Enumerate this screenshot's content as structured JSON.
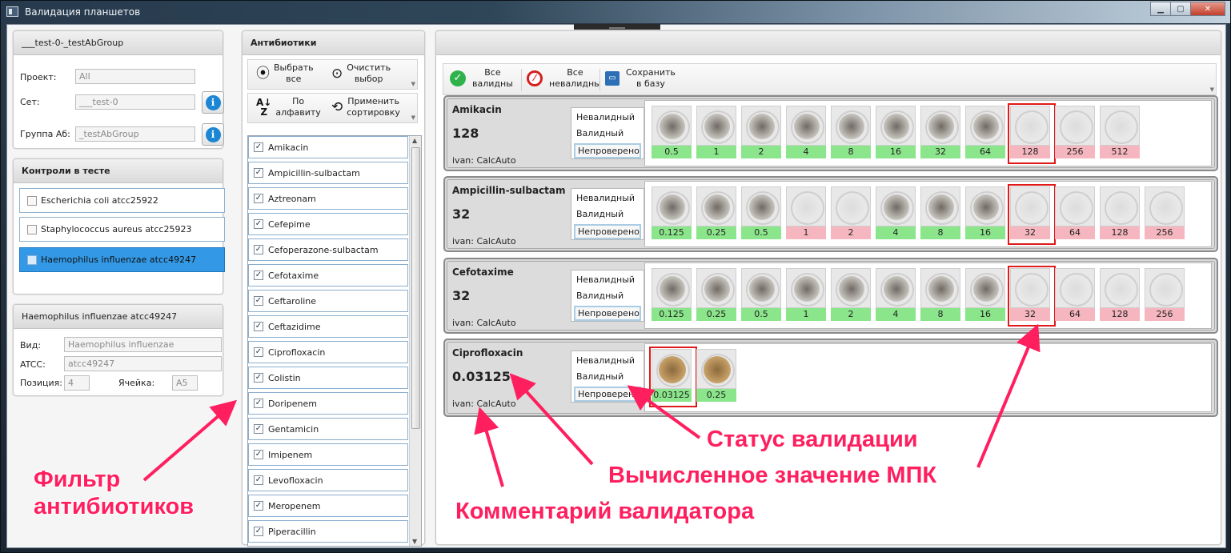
{
  "window": {
    "title": "Валидация планшетов",
    "buttons": [
      "minimize-icon",
      "maximize-icon",
      "close-icon"
    ]
  },
  "test_info": {
    "header": "___test-0-_testAbGroup",
    "project_label": "Проект:",
    "project_value": "All",
    "set_label": "Сет:",
    "set_value": "___test-0",
    "group_label": "Группа Аб:",
    "group_value": "_testAbGroup"
  },
  "controls": {
    "header": "Контроли в тесте",
    "items": [
      {
        "label": "Escherichia coli atcc25922",
        "selected": false
      },
      {
        "label": "Staphylococcus aureus atcc25923",
        "selected": false
      },
      {
        "label": "Haemophilus influenzae atcc49247",
        "selected": true
      }
    ]
  },
  "control_detail": {
    "header": "Haemophilus influenzae atcc49247",
    "species_label": "Вид:",
    "species_value": "Haemophilus influenzae",
    "atcc_label": "ATCC:",
    "atcc_value": "atcc49247",
    "position_label": "Позиция:",
    "position_value": "4",
    "cell_label": "Ячейка:",
    "cell_value": "A5"
  },
  "antibiotics_panel": {
    "header": "Антибиотики",
    "select_all": "Выбрать\nвсе",
    "clear": "Очистить\nвыбор",
    "sort_alpha": "По\nалфавиту",
    "apply_sort": "Применить\nсортировку",
    "items": [
      "Amikacin",
      "Ampicillin-sulbactam",
      "Aztreonam",
      "Cefepime",
      "Cefoperazone-sulbactam",
      "Cefotaxime",
      "Ceftaroline",
      "Ceftazidime",
      "Ciprofloxacin",
      "Colistin",
      "Doripenem",
      "Gentamicin",
      "Imipenem",
      "Levofloxacin",
      "Meropenem",
      "Piperacillin"
    ]
  },
  "right_toolbar": {
    "all_valid": "Все\nвалидны",
    "all_invalid": "Все\nневалидны",
    "save": "Сохранить\nв базу"
  },
  "status_options": {
    "invalid": "Невалидный",
    "valid": "Валидный",
    "unchecked": "Непроверено"
  },
  "results": [
    {
      "name": "Amikacin",
      "mic": "128",
      "comment": "ivan: CalcAuto",
      "wells": [
        {
          "value": "0.5",
          "result": "growth"
        },
        {
          "value": "1",
          "result": "growth"
        },
        {
          "value": "2",
          "result": "growth"
        },
        {
          "value": "4",
          "result": "growth"
        },
        {
          "value": "8",
          "result": "growth"
        },
        {
          "value": "16",
          "result": "growth"
        },
        {
          "value": "32",
          "result": "growth"
        },
        {
          "value": "64",
          "result": "growth"
        },
        {
          "value": "128",
          "result": "nogrowth",
          "mic": true
        },
        {
          "value": "256",
          "result": "nogrowth"
        },
        {
          "value": "512",
          "result": "nogrowth"
        }
      ]
    },
    {
      "name": "Ampicillin-sulbactam",
      "mic": "32",
      "comment": "ivan: CalcAuto",
      "wells": [
        {
          "value": "0.125",
          "result": "growth"
        },
        {
          "value": "0.25",
          "result": "growth"
        },
        {
          "value": "0.5",
          "result": "growth"
        },
        {
          "value": "1",
          "result": "nogrowth"
        },
        {
          "value": "2",
          "result": "nogrowth"
        },
        {
          "value": "4",
          "result": "growth"
        },
        {
          "value": "8",
          "result": "growth"
        },
        {
          "value": "16",
          "result": "growth"
        },
        {
          "value": "32",
          "result": "nogrowth",
          "mic": true
        },
        {
          "value": "64",
          "result": "nogrowth"
        },
        {
          "value": "128",
          "result": "nogrowth"
        },
        {
          "value": "256",
          "result": "nogrowth"
        }
      ]
    },
    {
      "name": "Cefotaxime",
      "mic": "32",
      "comment": "ivan: CalcAuto",
      "wells": [
        {
          "value": "0.125",
          "result": "growth"
        },
        {
          "value": "0.25",
          "result": "growth"
        },
        {
          "value": "0.5",
          "result": "growth"
        },
        {
          "value": "1",
          "result": "growth"
        },
        {
          "value": "2",
          "result": "growth"
        },
        {
          "value": "4",
          "result": "growth"
        },
        {
          "value": "8",
          "result": "growth"
        },
        {
          "value": "16",
          "result": "growth"
        },
        {
          "value": "32",
          "result": "nogrowth",
          "mic": true
        },
        {
          "value": "64",
          "result": "nogrowth"
        },
        {
          "value": "128",
          "result": "nogrowth"
        },
        {
          "value": "256",
          "result": "nogrowth"
        }
      ]
    },
    {
      "name": "Ciprofloxacin",
      "mic": "0.03125",
      "comment": "ivan: CalcAuto",
      "wells": [
        {
          "value": "0.03125",
          "result": "brown",
          "mic": true
        },
        {
          "value": "0.25",
          "result": "brown"
        }
      ]
    }
  ],
  "annotations": {
    "filter": "Фильтр\nантибиотиков",
    "status": "Статус валидации",
    "mic": "Вычисленное значение МПК",
    "comment": "Комментарий валидатора"
  },
  "colors": {
    "susceptible_label": "#8be58b",
    "resistant_label": "#f6b6c0",
    "mic_highlight": "#e01a1a",
    "annotation": "#ff1f5f",
    "selected_control": "#3399e6"
  }
}
